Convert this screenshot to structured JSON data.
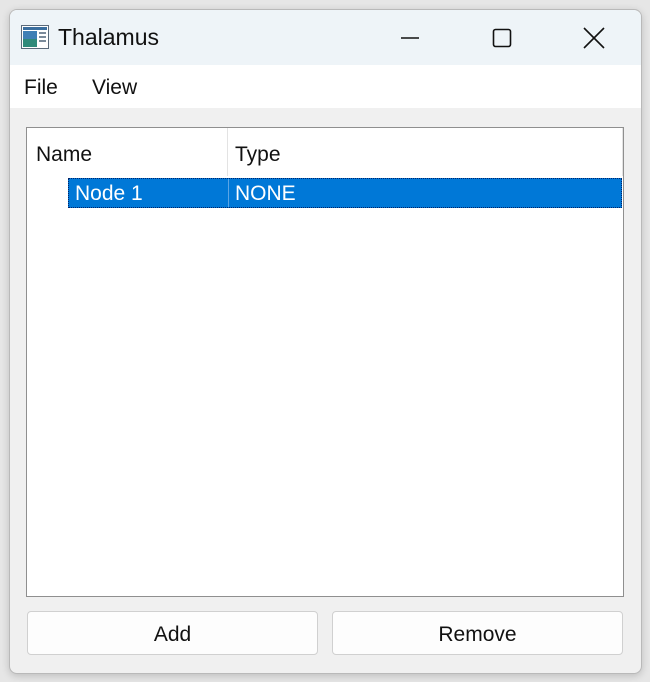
{
  "window": {
    "title": "Thalamus",
    "controls": {
      "minimize_icon": "minimize-icon",
      "maximize_icon": "maximize-icon",
      "close_icon": "close-icon"
    }
  },
  "menubar": {
    "items": [
      {
        "label": "File"
      },
      {
        "label": "View"
      }
    ]
  },
  "tree": {
    "columns": [
      {
        "label": "Name"
      },
      {
        "label": "Type"
      }
    ],
    "rows": [
      {
        "name": "Node 1",
        "type": "NONE",
        "selected": true
      }
    ]
  },
  "buttons": {
    "add_label": "Add",
    "remove_label": "Remove"
  },
  "colors": {
    "selection": "#0078d7",
    "titlebar": "#eef4f8"
  }
}
